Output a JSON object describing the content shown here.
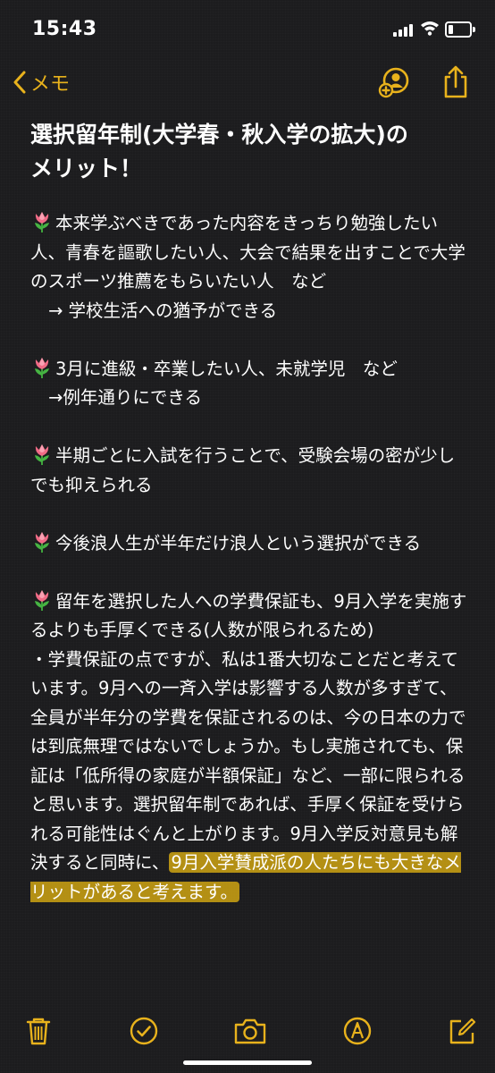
{
  "status_bar": {
    "time": "15:43"
  },
  "nav": {
    "back_label": "メモ",
    "back_icon": "chevron-left-icon",
    "share_person_icon": "add-person-icon",
    "share_icon": "share-icon"
  },
  "colors": {
    "accent": "#e8b21c",
    "background": "#1c1c1e",
    "highlight": "#d4a812"
  },
  "note": {
    "title_line1": "選択留年制(大学春・秋入学の拡大)の",
    "title_line2": "メリット！",
    "p1": "本来学ぶべきであった内容をきっちり勉強したい人、青春を謳歌したい人、大会で結果を出すことで大学のスポーツ推薦をもらいたい人　など",
    "p1_result": "→ 学校生活への猶予ができる",
    "p2": "3月に進級・卒業したい人、未就学児　など",
    "p2_result": "→例年通りにできる",
    "p3": "半期ごとに入試を行うことで、受験会場の密が少しでも抑えられる",
    "p4": "今後浪人生が半年だけ浪人という選択ができる",
    "p5": "留年を選択した人への学費保証も、9月入学を実施するよりも手厚くできる(人数が限られるため)",
    "p6_main": "・学費保証の点ですが、私は1番大切なことだと考えています。9月への一斉入学は影響する人数が多すぎて、全員が半年分の学費を保証されるのは、今の日本の力では到底無理ではないでしょうか。もし実施されても、保証は「低所得の家庭が半額保証」など、一部に限られると思います。選択留年制であれば、手厚く保証を受けられる可能性はぐんと上がります。9月入学反対意見も解決すると同時に、",
    "p6_highlight": "9月入学賛成派の人たちにも大きなメリットがあると考えます。",
    "bullet_icon": "tulip-icon"
  },
  "toolbar": {
    "icons": [
      "trash-icon",
      "checklist-icon",
      "camera-icon",
      "markup-icon",
      "compose-icon"
    ]
  }
}
